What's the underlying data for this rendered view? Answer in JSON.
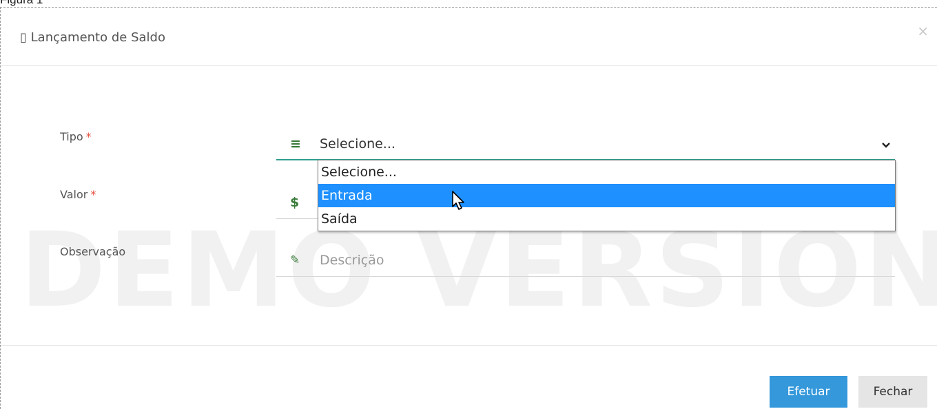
{
  "figure_caption": "Figura 1",
  "modal": {
    "title_icon": "▯",
    "title": "Lançamento de Saldo",
    "close_label": "×"
  },
  "watermark": "DEMO VERSION",
  "form": {
    "tipo": {
      "label": "Tipo",
      "required_mark": "*",
      "icon": "bars-icon",
      "icon_glyph": "≡",
      "value": "Selecione...",
      "options": [
        "Selecione...",
        "Entrada",
        "Saída"
      ],
      "highlighted_option": "Entrada"
    },
    "valor": {
      "label": "Valor",
      "required_mark": "*",
      "icon": "dollar-icon",
      "icon_glyph": "$"
    },
    "observacao": {
      "label": "Observação",
      "icon": "edit-icon",
      "icon_glyph": "✎",
      "placeholder": "Descrição"
    }
  },
  "footer": {
    "submit_label": "Efetuar",
    "close_label": "Fechar"
  },
  "colors": {
    "accent": "#2e9e8f",
    "primary_button": "#3498db",
    "highlight": "#1e90ff",
    "required": "#e74c3c",
    "icon_green": "#3a7d3a"
  }
}
